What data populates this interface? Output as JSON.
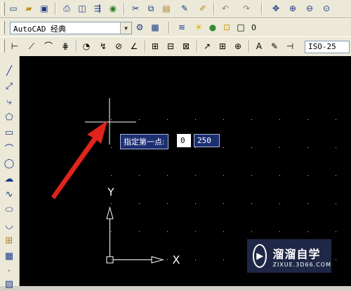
{
  "toolbar_standard": {
    "icons": [
      "new-file-icon",
      "open-file-icon",
      "save-icon",
      "plot-icon",
      "plot-preview-icon",
      "publish-icon",
      "3d-dwf-icon",
      "cut-icon",
      "copy-icon",
      "paste-icon",
      "match-properties-icon",
      "block-editor-icon",
      "undo-icon",
      "redo-icon",
      "pan-icon",
      "zoom-realtime-icon",
      "zoom-window-icon",
      "zoom-previous-icon"
    ]
  },
  "toolbar_workspace": {
    "workspace_value": "AutoCAD 经典",
    "layer_value": "0"
  },
  "toolbar_dimension": {
    "dimstyle_value": "ISO-25"
  },
  "canvas": {
    "prompt_label": "指定第一点:",
    "input_x": "0",
    "input_y": "250",
    "ucs_x_label": "X",
    "ucs_y_label": "Y"
  },
  "watermark": {
    "title": "溜溜自学",
    "subtitle": "ZIXUE.3D66.COM"
  },
  "colors": {
    "canvas_bg": "#000000",
    "arrow": "#e0241b",
    "crosshair": "#ffffff",
    "prompt_bg": "#1c2f72"
  }
}
